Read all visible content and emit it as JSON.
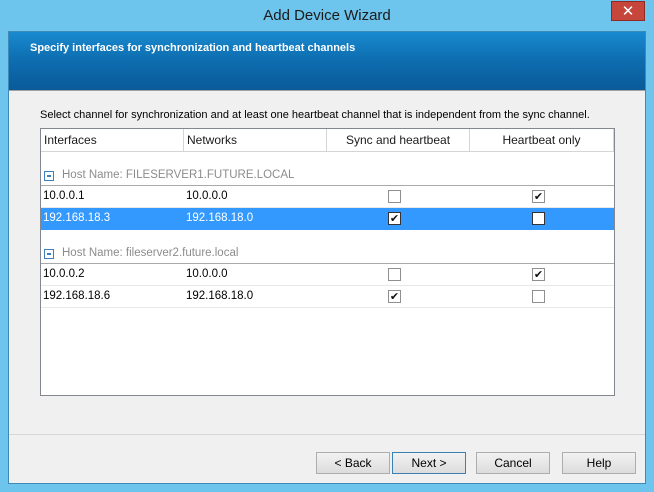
{
  "window": {
    "title": "Add Device Wizard",
    "close_glyph": "✕"
  },
  "banner": {
    "heading": "Specify interfaces for synchronization and heartbeat channels"
  },
  "instruction": "Select channel for synchronization and at least one heartbeat channel that is independent from the sync channel.",
  "grid": {
    "columns": {
      "interfaces": "Interfaces",
      "networks": "Networks",
      "sync": "Sync and heartbeat",
      "heartbeat": "Heartbeat only"
    },
    "groups": [
      {
        "label": "Host Name: FILESERVER1.FUTURE.LOCAL",
        "rows": [
          {
            "interface": "10.0.0.1",
            "network": "10.0.0.0",
            "sync": "",
            "heartbeat": "✔",
            "selected": false
          },
          {
            "interface": "192.168.18.3",
            "network": "192.168.18.0",
            "sync": "✔",
            "heartbeat": "",
            "selected": true
          }
        ]
      },
      {
        "label": "Host Name: fileserver2.future.local",
        "rows": [
          {
            "interface": "10.0.0.2",
            "network": "10.0.0.0",
            "sync": "",
            "heartbeat": "✔",
            "selected": false
          },
          {
            "interface": "192.168.18.6",
            "network": "192.168.18.0",
            "sync": "✔",
            "heartbeat": "",
            "selected": false
          }
        ]
      }
    ]
  },
  "buttons": {
    "back": "< Back",
    "next": "Next >",
    "cancel": "Cancel",
    "help": "Help"
  },
  "colors": {
    "title_bar": "#6dc4ec",
    "banner": "#0e6fb2",
    "selection": "#3399ff"
  }
}
